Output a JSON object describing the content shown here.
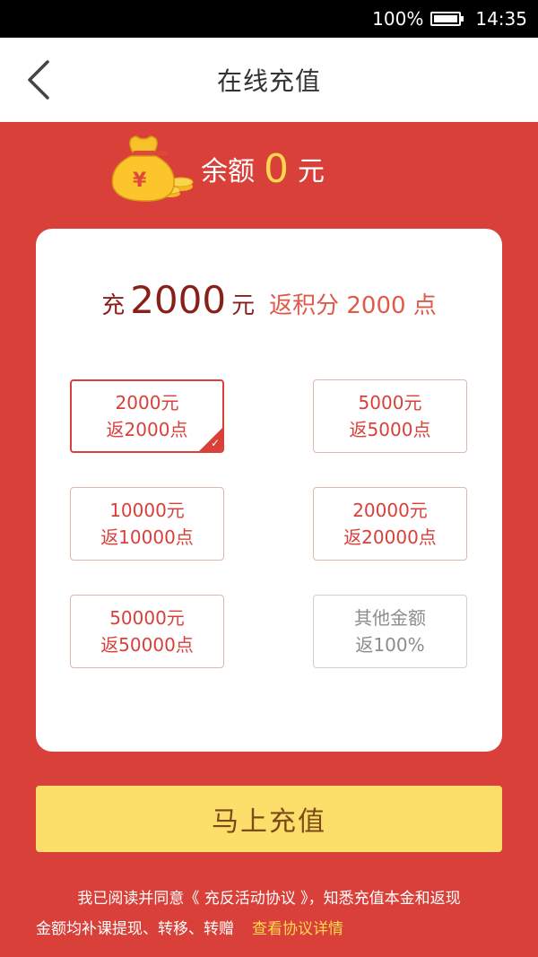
{
  "status_bar": {
    "battery_pct": "100%",
    "time": "14:35"
  },
  "nav": {
    "title": "在线充值"
  },
  "balance": {
    "label": "余额",
    "amount": "0",
    "unit": "元"
  },
  "summary": {
    "prefix": "充",
    "amount": "2000",
    "unit": "元",
    "bonus": "返积分 2000 点"
  },
  "options": [
    {
      "l1": "2000元",
      "l2": "返2000点",
      "selected": true
    },
    {
      "l1": "5000元",
      "l2": "返5000点"
    },
    {
      "l1": "10000元",
      "l2": "返10000点"
    },
    {
      "l1": "20000元",
      "l2": "返20000点"
    },
    {
      "l1": "50000元",
      "l2": "返50000点"
    },
    {
      "l1": "其他金额",
      "l2": "返100%"
    }
  ],
  "button": {
    "label": "马上充值"
  },
  "agreement": {
    "line1": "我已阅读并同意《 充反活动协议 》，知悉充值本金和返现",
    "line2": "金额均补课提现、转移、转赠",
    "link": "查看协议详情"
  },
  "colors": {
    "primary": "#d9403a",
    "accent": "#ffd84d",
    "button": "#fcdf6b"
  },
  "icons": {
    "back": "chevron-left-icon",
    "money_bag": "money-bag-icon",
    "check": "checkmark-icon",
    "battery": "battery-icon"
  }
}
